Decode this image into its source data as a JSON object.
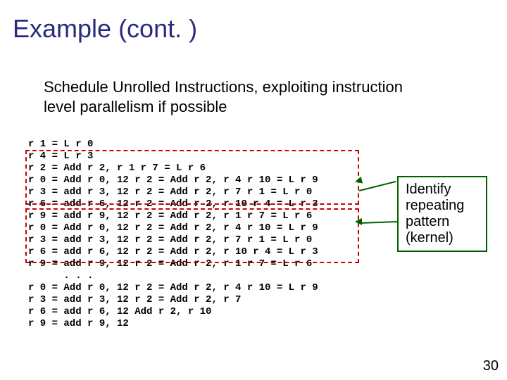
{
  "title": "Example (cont. )",
  "subtitle": "Schedule Unrolled Instructions, exploiting instruction level parallelism if possible",
  "code_lines": [
    "r 1 = L r 0",
    "r 4 = L r 3",
    "r 2 = Add r 2, r 1 r 7 = L r 6",
    "r 0 = Add r 0, 12 r 2 = Add r 2, r 4 r 10 = L r 9",
    "r 3 = add r 3, 12 r 2 = Add r 2, r 7 r 1 = L r 0",
    "r 6 = add r 6, 12 r 2 = Add r 2, r 10 r 4 = L r 3",
    "r 9 = add r 9, 12 r 2 = Add r 2, r 1 r 7 = L r 6",
    "r 0 = Add r 0, 12 r 2 = Add r 2, r 4 r 10 = L r 9",
    "r 3 = add r 3, 12 r 2 = Add r 2, r 7 r 1 = L r 0",
    "r 6 = add r 6, 12 r 2 = Add r 2, r 10 r 4 = L r 3",
    "r 9 = add r 9, 12 r 2 = Add r 2, r 1 r 7 = L r 6",
    "      . . .",
    "r 0 = Add r 0, 12 r 2 = Add r 2, r 4 r 10 = L r 9",
    "r 3 = add r 3, 12 r 2 = Add r 2, r 7",
    "r 6 = add r 6, 12 Add r 2, r 10",
    "r 9 = add r 9, 12"
  ],
  "label": {
    "l1": "Identify",
    "l2": "repeating",
    "l3": "pattern",
    "l4": "(kernel)"
  },
  "page_number": "30"
}
